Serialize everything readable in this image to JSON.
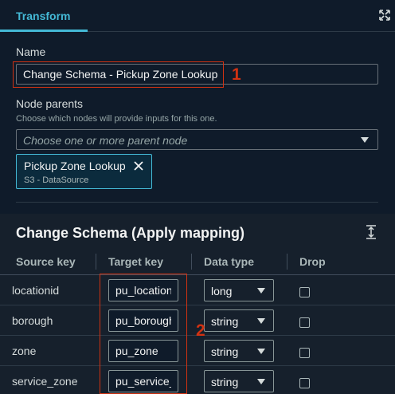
{
  "tabs": {
    "active": "Transform"
  },
  "form": {
    "name_label": "Name",
    "name_value": "Change Schema - Pickup Zone Lookup",
    "parents_label": "Node parents",
    "parents_description": "Choose which nodes will provide inputs for this one.",
    "parents_placeholder": "Choose one or more parent node",
    "selected_parent": {
      "title": "Pickup Zone Lookup",
      "subtitle": "S3 - DataSource"
    }
  },
  "mapping": {
    "title": "Change Schema (Apply mapping)",
    "columns": [
      "Source key",
      "Target key",
      "Data type",
      "Drop"
    ],
    "rows": [
      {
        "source": "locationid",
        "target": "pu_locationid",
        "type": "long",
        "drop": false
      },
      {
        "source": "borough",
        "target": "pu_borough",
        "type": "string",
        "drop": false
      },
      {
        "source": "zone",
        "target": "pu_zone",
        "type": "string",
        "drop": false
      },
      {
        "source": "service_zone",
        "target": "pu_service_zone",
        "type": "string",
        "drop": false
      }
    ]
  },
  "annotations": {
    "marker1": "1",
    "marker2": "2",
    "color": "#d13212"
  },
  "colors": {
    "accent": "#44b9d6",
    "background": "#0f1b2a",
    "section": "#16202c"
  }
}
